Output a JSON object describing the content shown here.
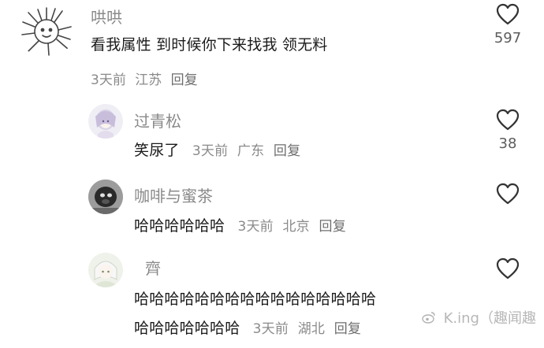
{
  "comments": [
    {
      "username": "哄哄",
      "text": "看我属性 到时候你下来找我 领无料",
      "time": "3天前",
      "location": "江苏",
      "reply": "回复",
      "likes": "597"
    },
    {
      "username": "过青松",
      "text": "笑尿了",
      "time": "3天前",
      "location": "广东",
      "reply": "回复",
      "likes": "38"
    },
    {
      "username": "咖啡与蜜茶",
      "text": "哈哈哈哈哈哈",
      "time": "3天前",
      "location": "北京",
      "reply": "回复",
      "likes": ""
    },
    {
      "username": "齊",
      "text_line1": "哈哈哈哈哈哈哈哈哈哈哈哈哈哈哈哈",
      "text_line2": "哈哈哈哈哈哈哈",
      "time": "3天前",
      "location": "湖北",
      "reply": "回复",
      "likes": ""
    }
  ],
  "watermark": "K.ing（趣闻趣",
  "icons": {
    "like": "heart-outline-icon",
    "avatar1": "sketch-avatar",
    "avatar2": "anime-girl-avatar",
    "avatar3": "photo-avatar",
    "avatar4": "anime-white-hair-avatar"
  }
}
